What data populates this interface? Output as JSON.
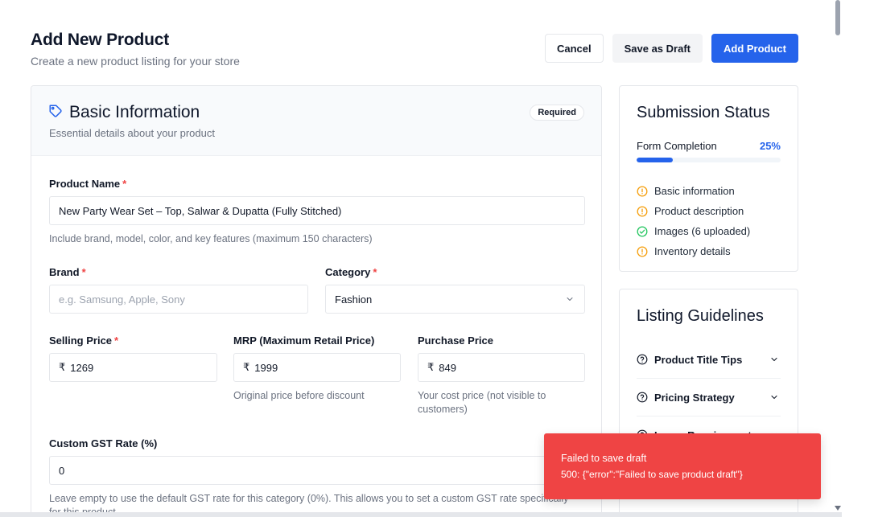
{
  "header": {
    "title": "Add New Product",
    "subtitle": "Create a new product listing for your store",
    "cancel_label": "Cancel",
    "draft_label": "Save as Draft",
    "add_label": "Add Product"
  },
  "basic_info": {
    "title": "Basic Information",
    "description": "Essential details about your product",
    "badge": "Required",
    "product_name": {
      "label": "Product Name",
      "required_mark": "*",
      "value": "New Party Wear Set – Top, Salwar & Dupatta (Fully Stitched)",
      "help": "Include brand, model, color, and key features (maximum 150 characters)"
    },
    "brand": {
      "label": "Brand",
      "required_mark": "*",
      "value": "",
      "placeholder": "e.g. Samsung, Apple, Sony"
    },
    "category": {
      "label": "Category",
      "required_mark": "*",
      "selected": "Fashion"
    },
    "selling_price": {
      "label": "Selling Price",
      "required_mark": "*",
      "currency": "₹",
      "value": "1269"
    },
    "mrp": {
      "label": "MRP (Maximum Retail Price)",
      "currency": "₹",
      "value": "1999",
      "help": "Original price before discount"
    },
    "purchase_price": {
      "label": "Purchase Price",
      "currency": "₹",
      "value": "849",
      "help": "Your cost price (not visible to customers)"
    },
    "gst": {
      "label": "Custom GST Rate (%)",
      "value": "0",
      "help": "Leave empty to use the default GST rate for this category (0%). This allows you to set a custom GST rate specifically for this product."
    }
  },
  "submission_status": {
    "title": "Submission Status",
    "completion_label": "Form Completion",
    "completion_value": "25%",
    "completion_fraction": 0.25,
    "items": [
      {
        "label": "Basic information",
        "state": "pending",
        "icon": "alert-circle-icon"
      },
      {
        "label": "Product description",
        "state": "pending",
        "icon": "alert-circle-icon"
      },
      {
        "label": "Images (6 uploaded)",
        "state": "done",
        "icon": "check-circle-icon"
      },
      {
        "label": "Inventory details",
        "state": "pending",
        "icon": "alert-circle-icon"
      }
    ]
  },
  "guidelines": {
    "title": "Listing Guidelines",
    "items": [
      {
        "label": "Product Title Tips"
      },
      {
        "label": "Pricing Strategy"
      },
      {
        "label": "Image Requirements"
      }
    ]
  },
  "toast": {
    "title": "Failed to save draft",
    "message": "500: {\"error\":\"Failed to save product draft\"}"
  },
  "colors": {
    "primary": "#2563eb",
    "error": "#ef4444",
    "pending": "#f59e0b",
    "success": "#22c55e"
  }
}
